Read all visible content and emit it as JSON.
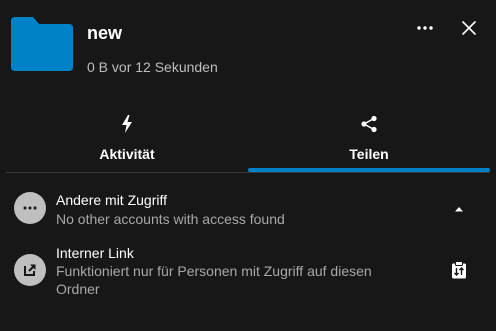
{
  "header": {
    "title": "new",
    "subtitle": "0 B vor 12 Sekunden",
    "folder_icon": "folder-icon",
    "folder_color": "#0082c9"
  },
  "actions": {
    "more_icon": "more-horizontal-icon",
    "close_icon": "close-icon"
  },
  "tabs": [
    {
      "label": "Aktivität",
      "icon": "lightning-icon",
      "active": false
    },
    {
      "label": "Teilen",
      "icon": "share-icon",
      "active": true
    }
  ],
  "accent_color": "#0082c9",
  "shares": [
    {
      "title": "Andere mit Zugriff",
      "subtitle": "No other accounts with access found",
      "icon": "more-horizontal-icon",
      "action_icon": "triangle-up-icon"
    },
    {
      "title": "Interner Link",
      "subtitle": "Funktioniert nur für Personen mit Zugriff auf diesen Ordner",
      "icon": "external-link-icon",
      "action_icon": "clipboard-copy-icon"
    }
  ]
}
